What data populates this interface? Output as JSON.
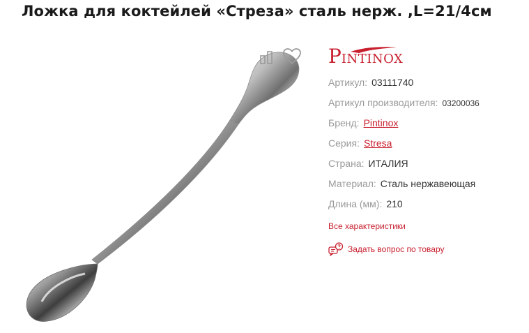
{
  "product": {
    "title": "Ложка для коктейлей «Стреза» сталь нерж. ,L=21/4см"
  },
  "brand_logo": {
    "text_first": "P",
    "text_rest": "INTINOX",
    "color": "#c8202f"
  },
  "specs": [
    {
      "label": "Артикул:",
      "value": "03111740"
    },
    {
      "label": "Артикул производителя:",
      "value": "03200036"
    },
    {
      "label": "Бренд:",
      "value": "Pintinox"
    },
    {
      "label": "Серия:",
      "value": "Stresa"
    },
    {
      "label": "Страна:",
      "value": "ИТАЛИЯ"
    },
    {
      "label": "Материал:",
      "value": "Сталь нержавеющая"
    },
    {
      "label": "Длина (мм):",
      "value": "210"
    }
  ],
  "links": {
    "all_specs": "Все характеристики",
    "ask_question": "Задать вопрос по товару"
  },
  "icons": {
    "compare": "compare-icon",
    "favorite": "heart-icon",
    "question": "chat-question-icon"
  },
  "colors": {
    "accent": "#c8202f",
    "label_gray": "#9a9a9a",
    "text": "#333333"
  }
}
